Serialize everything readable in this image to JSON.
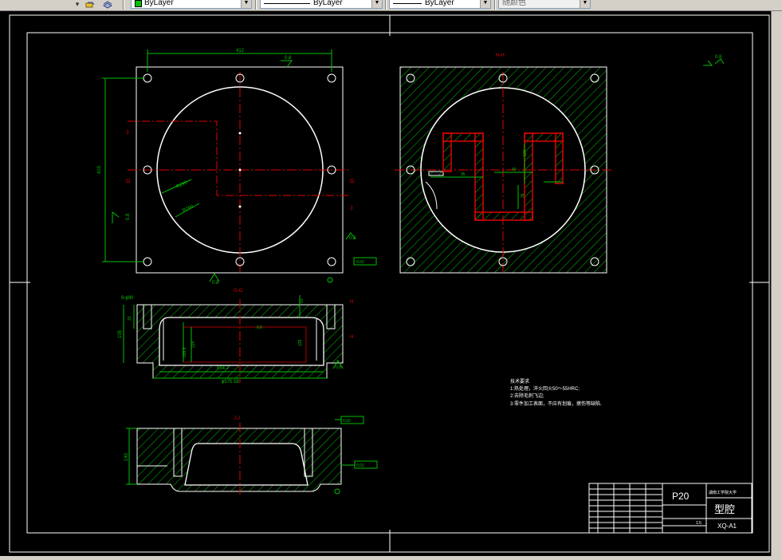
{
  "toolbar": {
    "icons": [
      "layer-state-icon",
      "layer-previous-icon"
    ],
    "color_combo": "ByLayer",
    "linetype_combo": "ByLayer",
    "lineweight_combo": "ByLayer",
    "plotstyle_combo": "随颜色",
    "color_swatch": "#00c000"
  },
  "drawing": {
    "view_top_label": "H-H",
    "view_front_label": "G-G",
    "view_bottom_label": "J-J",
    "dims": {
      "d412": "412",
      "d410": "410",
      "d0_8a": "0.8",
      "d0_8b": "0.8",
      "d0_8c": "0.8",
      "d0_8d": "0.8",
      "r295": "R295",
      "r260": "R260",
      "d9x90": "9-ϕ90",
      "d105": "105",
      "d33": "33",
      "d53": "53",
      "d139": "139",
      "d169": "169.8",
      "d234": "234",
      "d534": "534.2",
      "d575": "ϕ575.58",
      "d120": "120",
      "d40": "40",
      "d95": "95",
      "d140": "140",
      "d36": "36"
    },
    "section_letters": {
      "g": "G",
      "j": "J",
      "h": "H"
    },
    "gdt_flat": "0.02",
    "gdt_para": "0.02",
    "tech_req": {
      "title": "技术要求",
      "line1": "1:热处理，淬火回火50～55HRC;",
      "line2": "2:去除毛刺飞边;",
      "line3": "3:零件加工表面，不应有划痕，擦伤等缺陷."
    },
    "title_block": {
      "material": "P20",
      "school": "湖南工学院大学",
      "part_name": "型腔",
      "drawing_no": "XQ-A1",
      "scale": "1:5"
    }
  }
}
